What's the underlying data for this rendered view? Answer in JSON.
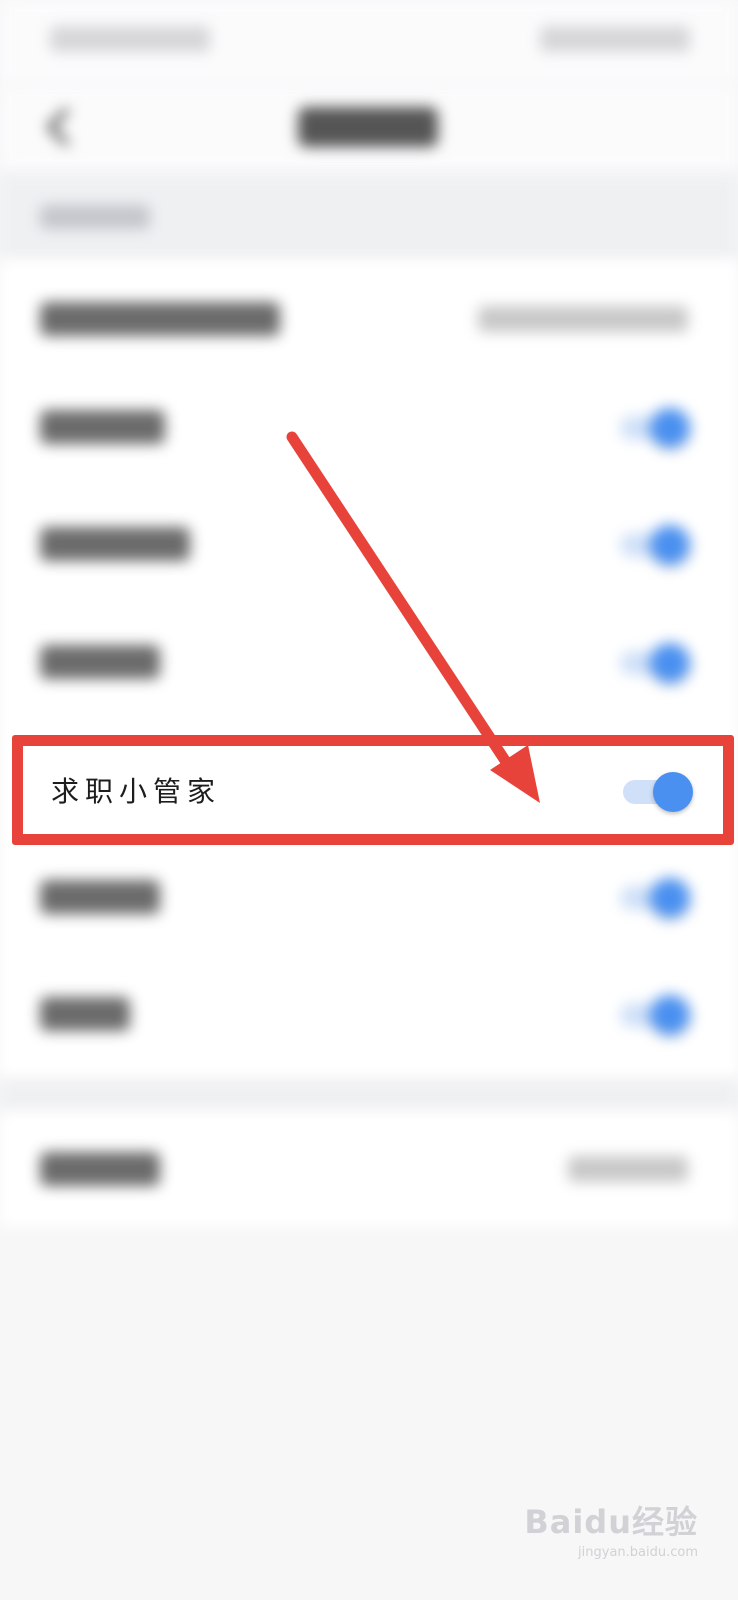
{
  "highlighted_item": {
    "label": "求职小管家",
    "toggle_on": true
  },
  "rows": [
    {
      "toggle_on": true
    },
    {
      "toggle_on": true
    },
    {
      "toggle_on": true
    },
    {
      "toggle_on": true
    },
    {
      "toggle_on": true
    }
  ],
  "watermark": {
    "main": "Baidu经验",
    "sub": "jingyan.baidu.com"
  },
  "colors": {
    "accent_blue": "#4a90f0",
    "annotation_red": "#e8433a"
  },
  "icons": {
    "back": "chevron-left-icon"
  }
}
